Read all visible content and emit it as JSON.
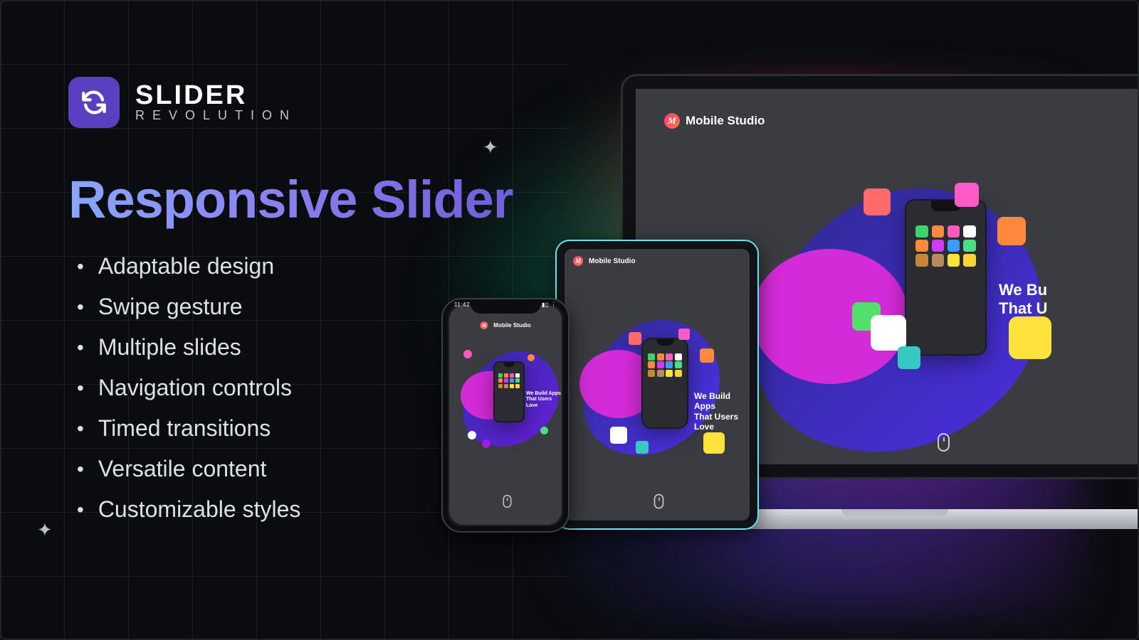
{
  "brand": {
    "top": "SLIDER",
    "bottom": "REVOLUTION"
  },
  "heading": "Responsive Slider",
  "features": [
    "Adaptable design",
    "Swipe gesture",
    "Multiple slides",
    "Navigation controls",
    "Timed transitions",
    "Versatile content",
    "Customizable styles"
  ],
  "mock": {
    "logo": "Mobile Studio",
    "logo_initial": "M",
    "tagline_l1": "We Build Apps",
    "tagline_l2": "That Users Love",
    "tagline_l1_cut": "We Bu",
    "tagline_l2_cut": "That U",
    "status_time": "11:42",
    "app_colors": [
      "#3bd46b",
      "#ff8a3d",
      "#ff5bbd",
      "#ffffff",
      "#ff8a3d",
      "#d23bff",
      "#3b9bff",
      "#4adf83",
      "#c8863b",
      "#b98b5e",
      "#ffe23b",
      "#ffd43b"
    ]
  },
  "colors": {
    "accent": "#5a3fc0"
  }
}
